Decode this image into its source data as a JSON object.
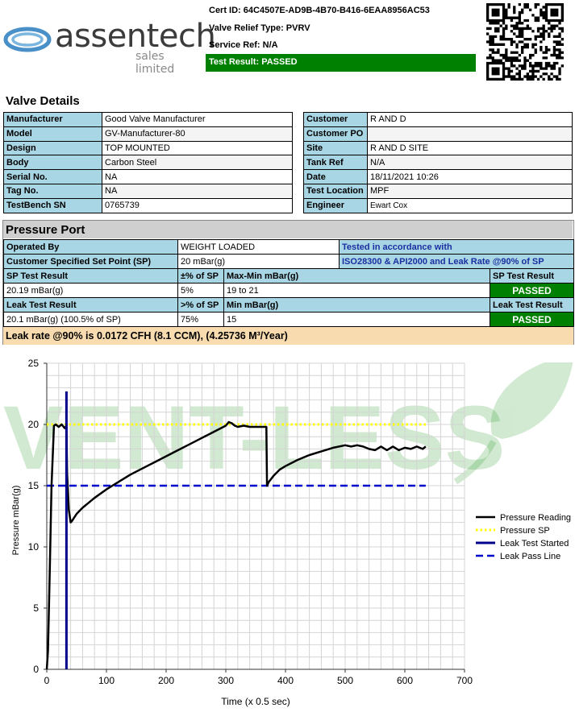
{
  "logo": {
    "name": "assentech",
    "tagline": "sales limited"
  },
  "header": {
    "cert_id": "Cert ID: 64C4507E-AD9B-4B70-B416-6EAA8956AC53",
    "valve_relief_type": "Valve Relief Type: PVRV",
    "service_ref": "Service Ref: N/A",
    "test_result": "Test Result: PASSED"
  },
  "watermark": "VENT-LESS",
  "valve_details": {
    "title": "Valve Details",
    "left": [
      {
        "label": "Manufacturer",
        "value": "Good Valve Manufacturer"
      },
      {
        "label": "Model",
        "value": "GV-Manufacturer-80"
      },
      {
        "label": "Design",
        "value": "TOP MOUNTED"
      },
      {
        "label": "Body",
        "value": "Carbon Steel"
      },
      {
        "label": "Serial No.",
        "value": "NA"
      },
      {
        "label": "Tag No.",
        "value": "NA"
      },
      {
        "label": "TestBench SN",
        "value": "0765739"
      }
    ],
    "right": [
      {
        "label": "Customer",
        "value": "R AND D"
      },
      {
        "label": "Customer PO",
        "value": ""
      },
      {
        "label": "Site",
        "value": "R AND D SITE"
      },
      {
        "label": "Tank Ref",
        "value": "N/A"
      },
      {
        "label": "Date",
        "value": "18/11/2021 10:26"
      },
      {
        "label": "Test Location",
        "value": "MPF"
      },
      {
        "label": "Engineer",
        "value": "Ewart Cox"
      }
    ]
  },
  "pressure_port": {
    "title": "Pressure Port",
    "operated_by_label": "Operated By",
    "operated_by": "WEIGHT LOADED",
    "tested_label": "Tested in accordance with",
    "sp_label": "Customer Specified Set Point (SP)",
    "sp_value": "20 mBar(g)",
    "standard": "ISO28300 & API2000 and Leak Rate @90% of SP",
    "sp_hdr": {
      "c1": "SP Test Result",
      "c2": "±% of SP",
      "c3": "Max-Min  mBar(g)",
      "c4": "SP Test Result"
    },
    "sp_row": {
      "c1": "20.19 mBar(g)",
      "c2": "5%",
      "c3": "19 to 21",
      "c4": "PASSED"
    },
    "leak_hdr": {
      "c1": "Leak Test Result",
      "c2": ">% of SP",
      "c3": "Min  mBar(g)",
      "c4": "Leak Test Result"
    },
    "leak_row": {
      "c1": "20.1 mBar(g) (100.5% of SP)",
      "c2": "75%",
      "c3": "15",
      "c4": "PASSED"
    },
    "leak_rate": "Leak rate @90% is 0.0172 CFH (8.1 CCM), (4.25736 M³/Year)"
  },
  "chart_data": {
    "type": "line",
    "xlabel": "Time (x 0.5 sec)",
    "ylabel": "Pressure mBar(g)",
    "xlim": [
      0,
      700
    ],
    "ylim": [
      0,
      25
    ],
    "xticks": [
      0,
      100,
      200,
      300,
      400,
      500,
      600,
      700
    ],
    "yticks": [
      0,
      5,
      10,
      15,
      20,
      25
    ],
    "grid": true,
    "legend_position": "right",
    "series": [
      {
        "name": "Pressure Reading",
        "color": "#000000",
        "style": "solid",
        "x": [
          0,
          2,
          5,
          8,
          12,
          15,
          20,
          25,
          30,
          33,
          34,
          37,
          40,
          42,
          50,
          60,
          70,
          80,
          100,
          120,
          140,
          160,
          180,
          200,
          220,
          240,
          260,
          280,
          300,
          305,
          310,
          315,
          320,
          330,
          340,
          350,
          360,
          368,
          369,
          372,
          380,
          390,
          400,
          420,
          440,
          460,
          480,
          500,
          510,
          520,
          530,
          540,
          550,
          560,
          570,
          580,
          590,
          600,
          610,
          620,
          630,
          635
        ],
        "y": [
          0,
          1.5,
          8,
          15,
          19.9,
          20,
          19.8,
          20,
          19.7,
          19.9,
          16,
          13,
          12,
          12.1,
          12.7,
          13.2,
          13.6,
          14,
          14.7,
          15.3,
          15.9,
          16.4,
          16.9,
          17.4,
          17.9,
          18.4,
          18.9,
          19.4,
          19.9,
          20.2,
          20.1,
          19.9,
          19.8,
          19.9,
          19.8,
          19.8,
          19.8,
          19.8,
          15,
          15.3,
          15.8,
          16.3,
          16.6,
          17.1,
          17.5,
          17.8,
          18.1,
          18.3,
          18.2,
          18.3,
          18.2,
          18.0,
          17.9,
          18.2,
          17.9,
          18.2,
          17.9,
          18.1,
          18.0,
          18.2,
          18.0,
          18.2
        ]
      },
      {
        "name": "Pressure SP",
        "color": "#ffff00",
        "style": "dotted",
        "x": [
          0,
          635
        ],
        "y": [
          20,
          20
        ]
      },
      {
        "name": "Leak Test Started",
        "color": "#00008b",
        "style": "solid",
        "x": [
          33,
          33
        ],
        "y": [
          0,
          22.7
        ]
      },
      {
        "name": "Leak Pass Line",
        "color": "#0000cd",
        "style": "dashed",
        "x": [
          0,
          635
        ],
        "y": [
          15,
          15
        ]
      }
    ]
  }
}
